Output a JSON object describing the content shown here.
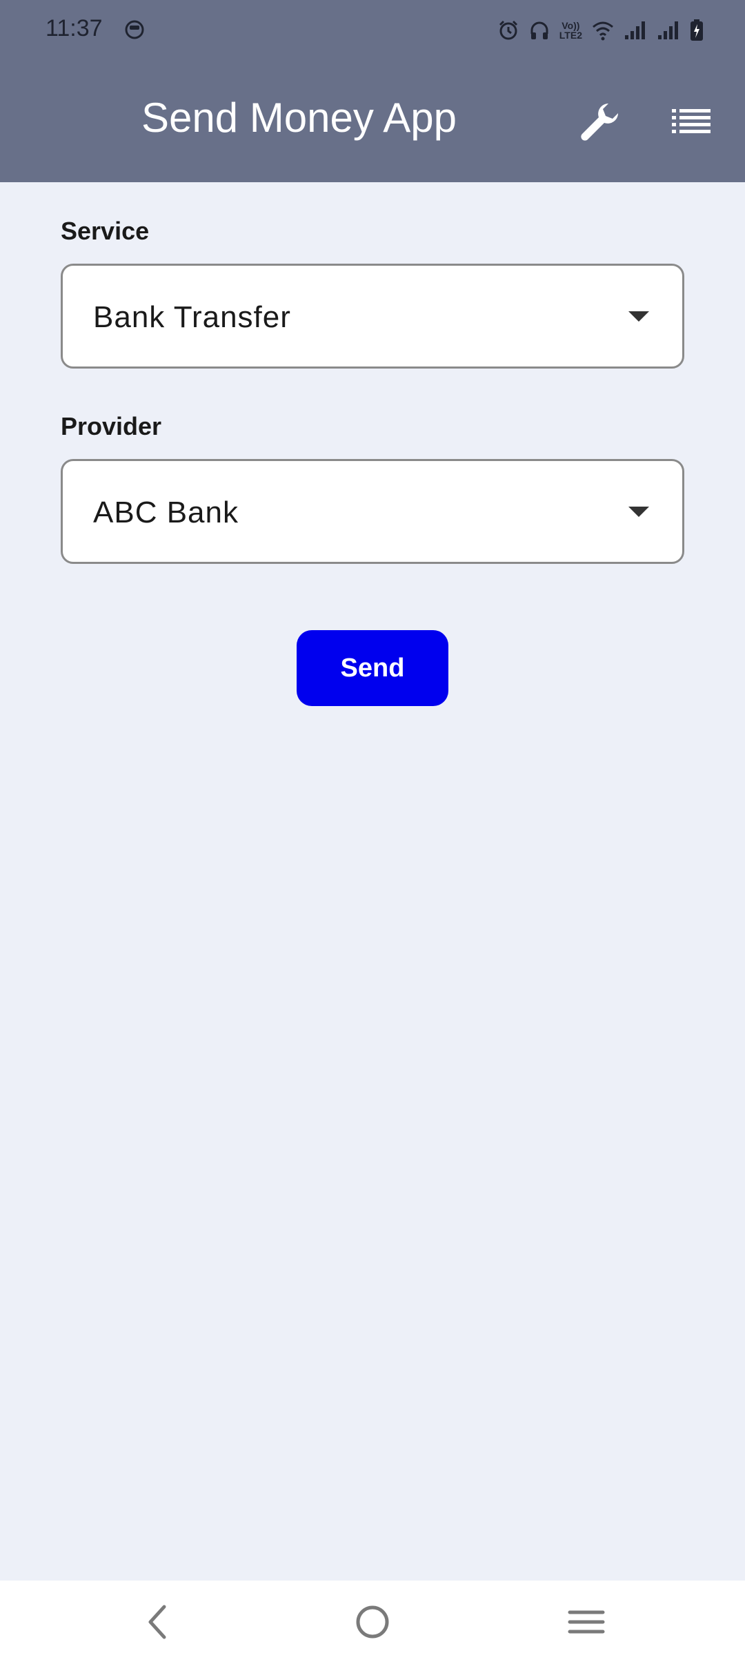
{
  "status_bar": {
    "time": "11:37",
    "volte_line1": "Vo))",
    "volte_line2": "LTE2"
  },
  "app_bar": {
    "title": "Send Money App",
    "background_color": "#687089",
    "actions": [
      "wrench-icon",
      "list-icon"
    ]
  },
  "form": {
    "service": {
      "label": "Service",
      "selected": "Bank Transfer"
    },
    "provider": {
      "label": "Provider",
      "selected": "ABC Bank"
    },
    "send_button": {
      "label": "Send",
      "color": "#0000ee"
    }
  },
  "nav_bar": {
    "buttons": [
      "back-icon",
      "home-icon",
      "menu-icon"
    ]
  },
  "colors": {
    "page_background": "#edf0f8"
  }
}
